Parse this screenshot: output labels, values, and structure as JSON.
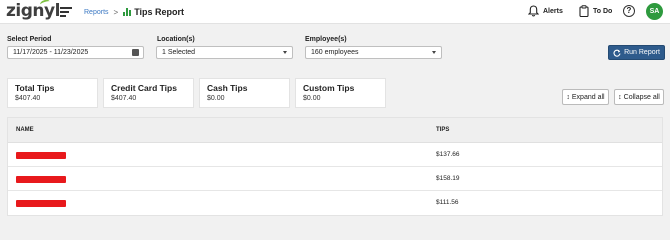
{
  "header": {
    "logo": "zignyl",
    "breadcrumb_link": "Reports",
    "breadcrumb_sep": ">",
    "title": "Tips Report",
    "alerts_label": "Alerts",
    "todo_label": "To Do",
    "help_label": "?",
    "avatar_initials": "SA"
  },
  "filters": {
    "period_label": "Select Period",
    "period_value": "11/17/2025 - 11/23/2025",
    "location_label": "Location(s)",
    "location_value": "1 Selected",
    "employee_label": "Employee(s)",
    "employee_value": "160 employees",
    "run_label": "Run Report"
  },
  "summary": [
    {
      "title": "Total Tips",
      "value": "$407.40"
    },
    {
      "title": "Credit Card Tips",
      "value": "$407.40"
    },
    {
      "title": "Cash Tips",
      "value": "$0.00"
    },
    {
      "title": "Custom Tips",
      "value": "$0.00"
    }
  ],
  "actions": {
    "expand_label": "Expand all",
    "collapse_label": "Collapse all"
  },
  "table": {
    "columns": [
      "NAME",
      "TIPS"
    ],
    "rows": [
      {
        "tips": "$137.66"
      },
      {
        "tips": "$158.19"
      },
      {
        "tips": "$111.56"
      }
    ]
  },
  "colors": {
    "accent_green": "#2e9a3e",
    "run_button": "#2e5b8c",
    "link_blue": "#3b78c3",
    "redaction": "#e8191c"
  }
}
